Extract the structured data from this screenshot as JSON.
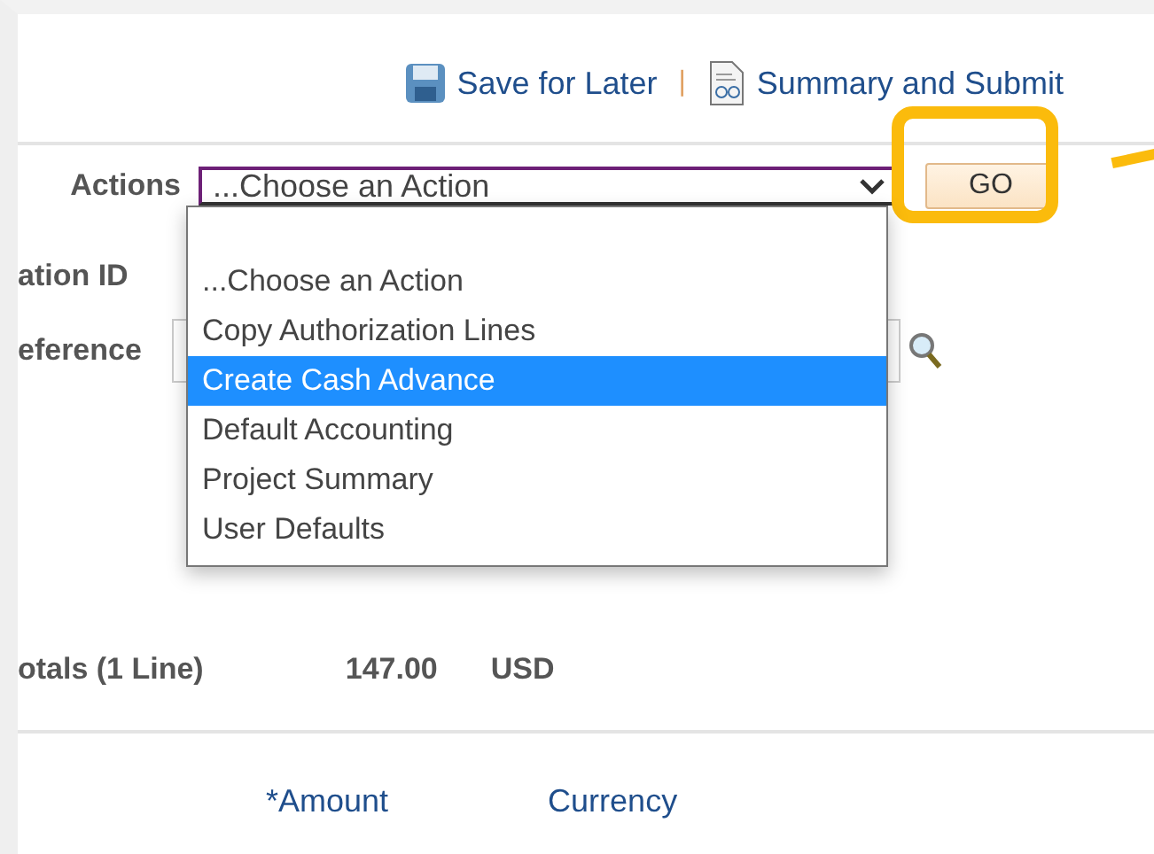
{
  "toolbar": {
    "links": [
      {
        "kind": "save",
        "label": "Save for Later"
      },
      {
        "kind": "submit",
        "label": "Summary and Submit"
      }
    ],
    "separator": "|"
  },
  "actions": {
    "label": "Actions",
    "select_value": "...Choose an Action",
    "button": "GO",
    "button_highlighted": true,
    "options": [
      {
        "label": "...Choose an Action",
        "selected": false
      },
      {
        "label": "Copy Authorization Lines",
        "selected": false
      },
      {
        "label": "Create Cash Advance",
        "selected": true
      },
      {
        "label": "Default Accounting",
        "selected": false
      },
      {
        "label": "Project Summary",
        "selected": false
      },
      {
        "label": "User Defaults",
        "selected": false
      }
    ]
  },
  "fields": [
    {
      "label": "ation ID",
      "kind": "text"
    },
    {
      "label": "eference",
      "kind": "lookup"
    }
  ],
  "totals": {
    "label": "otals (1 Line)",
    "amount": "147.00",
    "currency": "USD"
  },
  "columns": [
    "*Amount",
    "Currency"
  ]
}
